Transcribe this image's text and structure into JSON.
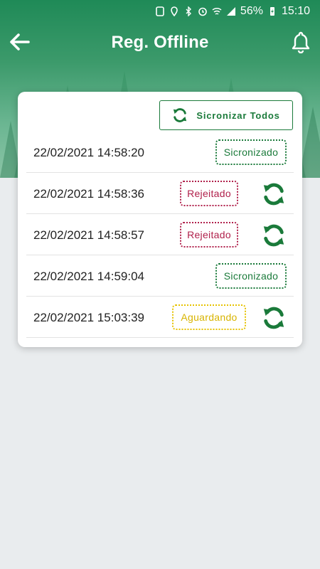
{
  "status_bar": {
    "battery": "56%",
    "time": "15:10"
  },
  "app_bar": {
    "title": "Reg. Offline",
    "back_icon": "arrow-left-icon",
    "notify_icon": "bell-icon"
  },
  "card": {
    "sync_all_label": "Sicronizar Todos",
    "records": [
      {
        "datetime": "22/02/2021 14:58:20",
        "status": "Sicronizado",
        "kind": "ok",
        "can_sync": false
      },
      {
        "datetime": "22/02/2021 14:58:36",
        "status": "Rejeitado",
        "kind": "rej",
        "can_sync": true
      },
      {
        "datetime": "22/02/2021 14:58:57",
        "status": "Rejeitado",
        "kind": "rej",
        "can_sync": true
      },
      {
        "datetime": "22/02/2021 14:59:04",
        "status": "Sicronizado",
        "kind": "ok",
        "can_sync": false
      },
      {
        "datetime": "22/02/2021 15:03:39",
        "status": "Aguardando",
        "kind": "wait",
        "can_sync": true
      }
    ]
  },
  "colors": {
    "primary_green": "#1a7a3a",
    "rejected": "#b0204b",
    "waiting": "#e6c200"
  }
}
